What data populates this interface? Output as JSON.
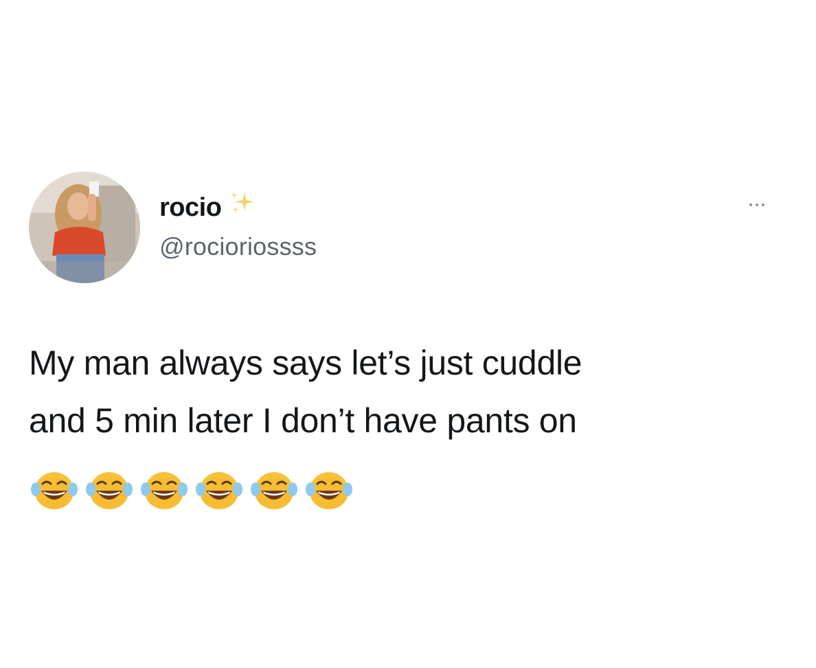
{
  "author": {
    "display_name": "rocio",
    "decoration_icon": "sparkles-icon",
    "handle": "@rocioriossss",
    "avatar": "avatar-photo"
  },
  "menu": {
    "icon": "more-options-icon"
  },
  "tweet": {
    "line1": "My man always says let’s just cuddle",
    "line2": "and 5 min later I don’t have pants on",
    "emoji_icon": "face-with-tears-of-joy-icon",
    "emoji_count": 6
  },
  "colors": {
    "background": "#ffffff",
    "text": "#14171a",
    "handle": "#5b6570",
    "emoji_yellow": "#f7c23a"
  }
}
